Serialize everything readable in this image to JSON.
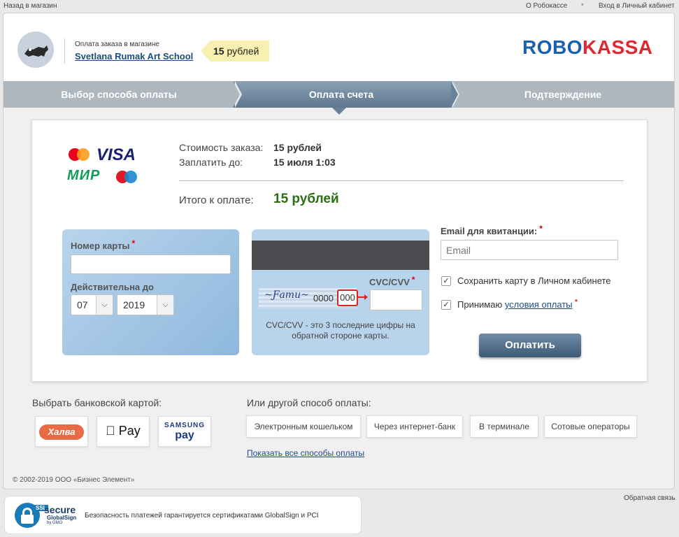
{
  "topbar": {
    "back": "Назад в магазин",
    "about": "О Робокассе",
    "separator": "•",
    "login": "Вход в Личный кабинет"
  },
  "header": {
    "shop_caption": "Оплата заказа в магазине",
    "shop_name": "Svetlana Rumak Art School",
    "price_amount": "15",
    "price_currency": "рублей",
    "logo_part1": "ROBO",
    "logo_part2": "KASSA"
  },
  "steps": [
    {
      "label": "Выбор способа оплаты",
      "active": false
    },
    {
      "label": "Оплата счета",
      "active": true
    },
    {
      "label": "Подтверждение",
      "active": false
    }
  ],
  "brands": {
    "visa": "VISA",
    "mir": "МИР"
  },
  "order": {
    "cost_label": "Стоимость заказа:",
    "cost_value": "15 рублей",
    "due_label": "Заплатить до:",
    "due_value": "15 июля 1:03",
    "total_label": "Итого к оплате:",
    "total_value": "15 рублей"
  },
  "form": {
    "card_number_label": "Номер карты",
    "required_mark": "*",
    "card_number_value": "",
    "expiry_label": "Действительна до",
    "expiry_month": "07",
    "expiry_year": "2019",
    "cvc_label": "CVC/CVV",
    "cvc_sample_prefix": "0000",
    "cvc_sample": "000",
    "cvc_note": "CVC/CVV - это 3 последние цифры на обратной стороне карты.",
    "email_label": "Email для квитанции:",
    "email_placeholder": "Email",
    "save_card_label": "Сохранить карту в Личном кабинете",
    "save_card_checked": true,
    "accept_prefix": "Принимаю",
    "accept_link": "условия оплаты",
    "accept_checked": true,
    "checkmark": "✓",
    "pay_button": "Оплатить"
  },
  "bank_cards": {
    "title": "Выбрать банковской картой:",
    "halva": "Халва",
    "apple_pay": " Pay",
    "samsung_l1": "SAMSUNG",
    "samsung_l2": "pay"
  },
  "other_methods": {
    "title": "Или другой способ оплаты:",
    "buttons": [
      "Электронным кошельком",
      "Через интернет-банк",
      "В терминале",
      "Сотовые операторы"
    ],
    "show_all": "Показать все способы оплаты"
  },
  "footer": {
    "copyright": "© 2002-2019 ООО «Бизнес Элемент»",
    "feedback": "Обратная связь",
    "ssl": "SSL",
    "secure": "secure",
    "globalsign": "GlobalSign",
    "gmo": "by GMO",
    "security_text": "Безопасность платежей гарантируется сертификатами GlobalSign и PCI"
  },
  "colors": {
    "accent_blue": "#1b5fb0",
    "accent_red": "#e0262e",
    "total_green": "#2a6e12"
  }
}
